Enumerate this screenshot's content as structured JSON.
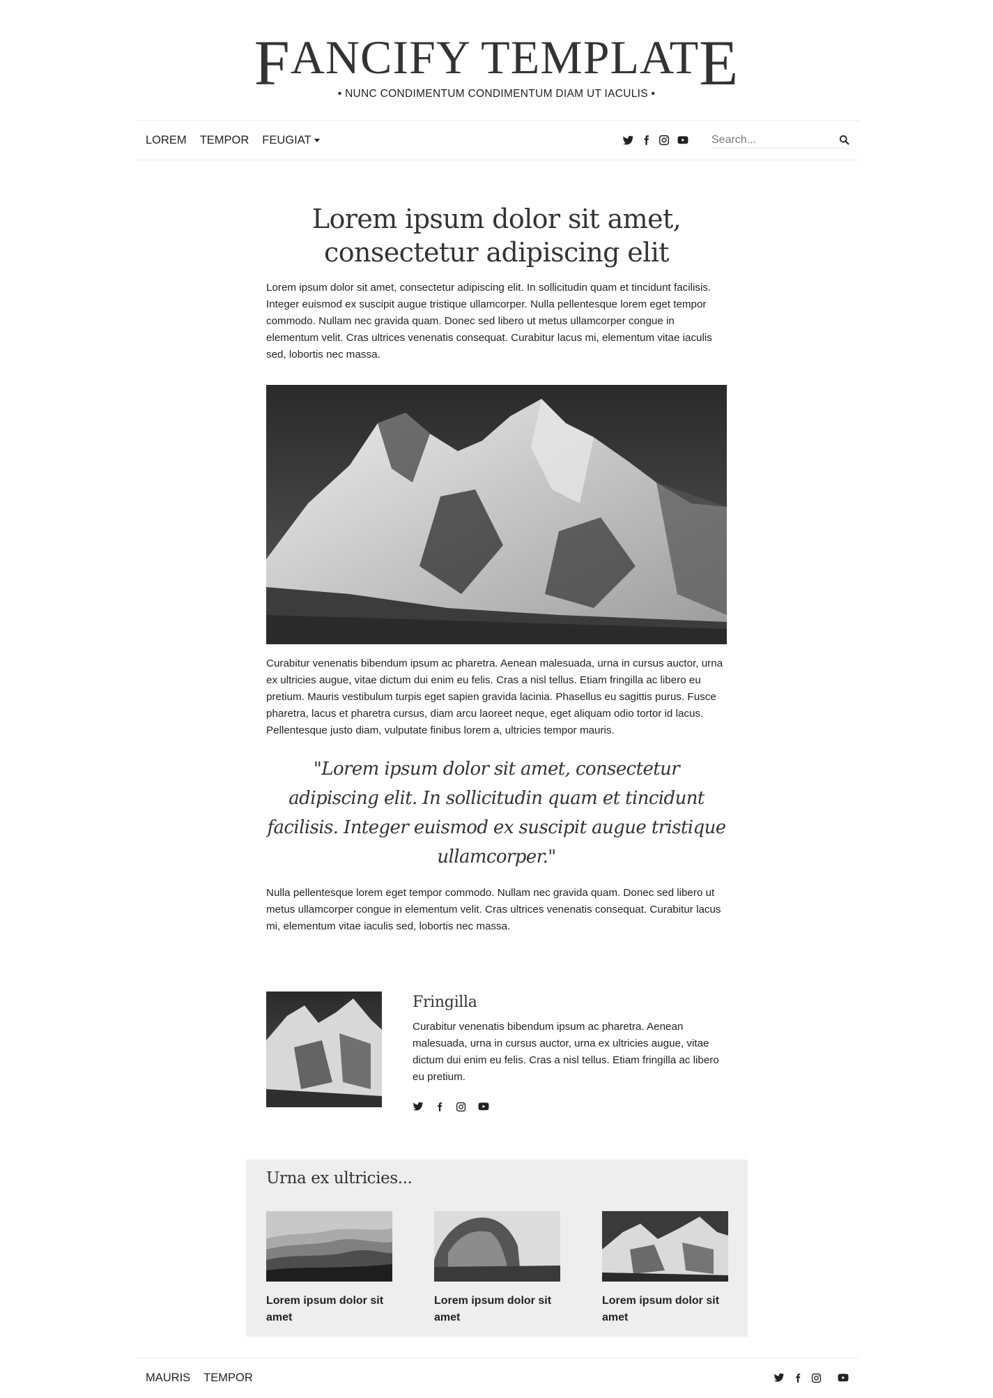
{
  "header": {
    "logo_cap_first": "F",
    "logo_middle": "ANCIFY TEMPLAT",
    "logo_cap_last": "E",
    "tagline": "• NUNC CONDIMENTUM CONDIMENTUM DIAM UT IACULIS •"
  },
  "nav": {
    "items": [
      "LOREM",
      "TEMPOR",
      "FEUGIAT"
    ],
    "social_icons": [
      "twitter-icon",
      "facebook-icon",
      "instagram-icon",
      "youtube-icon"
    ],
    "search_placeholder": "Search..."
  },
  "article": {
    "title": "Lorem ipsum dolor sit amet, consectetur adipiscing elit",
    "paragraph_1": "Lorem ipsum dolor sit amet, consectetur adipiscing elit. In sollicitudin quam et tincidunt facilisis. Integer euismod ex suscipit augue tristique ullamcorper. Nulla pellentesque lorem eget tempor commodo. Nullam nec gravida quam. Donec sed libero ut metus ullamcorper congue in elementum velit. Cras ultrices venenatis consequat. Curabitur lacus mi, elementum vitae iaculis sed, lobortis nec massa.",
    "paragraph_2": "Curabitur venenatis bibendum ipsum ac pharetra. Aenean malesuada, urna in cursus auctor, urna ex ultricies augue, vitae dictum dui enim eu felis. Cras a nisl tellus. Etiam fringilla ac libero eu pretium. Mauris vestibulum turpis eget sapien gravida lacinia. Phasellus eu sagittis purus. Fusce pharetra, lacus et pharetra cursus, diam arcu laoreet neque, eget aliquam odio tortor id lacus. Pellentesque justo diam, vulputate finibus lorem a, ultricies tempor mauris.",
    "quote": "\"Lorem ipsum dolor sit amet, consectetur adipiscing elit. In sollicitudin quam et tincidunt facilisis. Integer euismod ex suscipit augue tristique ullamcorper.\"",
    "paragraph_3": "Nulla pellentesque lorem eget tempor commodo. Nullam nec gravida quam. Donec sed libero ut metus ullamcorper congue in elementum velit. Cras ultrices venenatis consequat. Curabitur lacus mi, elementum vitae iaculis sed, lobortis nec massa."
  },
  "author": {
    "name": "Fringilla",
    "bio": "Curabitur venenatis bibendum ipsum ac pharetra. Aenean malesuada, urna in cursus auctor, urna ex ultricies augue, vitae dictum dui enim eu felis. Cras a nisl tellus. Etiam fringilla ac libero eu pretium.",
    "social_icons": [
      "twitter-icon",
      "facebook-icon",
      "instagram-icon",
      "youtube-icon"
    ]
  },
  "related": {
    "title": "Urna ex ultricies...",
    "cards": [
      {
        "title": "Lorem ipsum dolor sit amet"
      },
      {
        "title": "Lorem ipsum dolor sit amet"
      },
      {
        "title": "Lorem ipsum dolor sit amet"
      }
    ]
  },
  "footer": {
    "items": [
      "MAURIS",
      "TEMPOR"
    ],
    "social_icons": [
      "twitter-icon",
      "facebook-icon",
      "instagram-icon",
      "youtube-icon"
    ]
  },
  "colors": {
    "text": "#222222",
    "heading": "#333333",
    "related_bg": "#eeeeee",
    "rule": "#ececec"
  }
}
